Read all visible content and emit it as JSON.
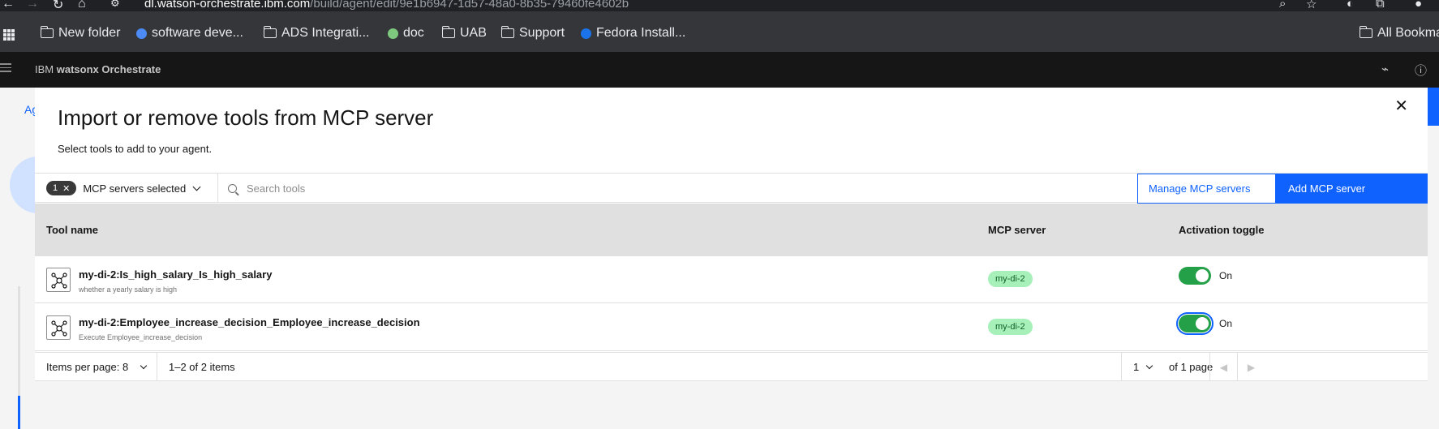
{
  "browser": {
    "url_host": "dl.watson-orchestrate.ibm.com",
    "url_path": "/build/agent/edit/9e1b6947-1d57-48a0-8b35-79460fe4602b",
    "bookmarks": [
      {
        "label": "New folder",
        "icon": "folder-icon"
      },
      {
        "label": "software deve...",
        "icon": "globe-icon"
      },
      {
        "label": "ADS Integrati...",
        "icon": "folder-icon"
      },
      {
        "label": "doc",
        "icon": "doc-icon"
      },
      {
        "label": "UAB",
        "icon": "folder-icon"
      },
      {
        "label": "Support",
        "icon": "folder-icon"
      },
      {
        "label": "Fedora Install...",
        "icon": "cloud-icon"
      }
    ],
    "all_bookmarks": "All Bookma"
  },
  "app": {
    "brand": "IBM",
    "product": "watsonx Orchestrate"
  },
  "underlay": {
    "tab_fragment": "Ag"
  },
  "modal": {
    "title": "Import or remove tools from MCP server",
    "subtitle": "Select tools to add to your agent.",
    "filter": {
      "count": "1",
      "label": "MCP servers selected"
    },
    "search_placeholder": "Search tools",
    "manage_button": "Manage MCP servers",
    "add_button": "Add MCP server",
    "columns": {
      "tool_name": "Tool name",
      "mcp_server": "MCP server",
      "activation": "Activation toggle"
    },
    "rows": [
      {
        "name": "my-di-2:Is_high_salary_Is_high_salary",
        "description": "whether a yearly salary is high",
        "server": "my-di-2",
        "toggle_label": "On",
        "active": true
      },
      {
        "name": "my-di-2:Employee_increase_decision_Employee_increase_decision",
        "description": "Execute Employee_increase_decision",
        "server": "my-di-2",
        "toggle_label": "On",
        "active": true
      }
    ],
    "pagination": {
      "items_per_page_label": "Items per page:",
      "items_per_page": "8",
      "range": "1–2 of 2 items",
      "page": "1",
      "of_pages": "of 1 page"
    }
  },
  "colors": {
    "accent": "#0f62fe",
    "toggle_on": "#24a148",
    "tag_bg": "#a7f0ba",
    "tag_text": "#0e6027"
  }
}
